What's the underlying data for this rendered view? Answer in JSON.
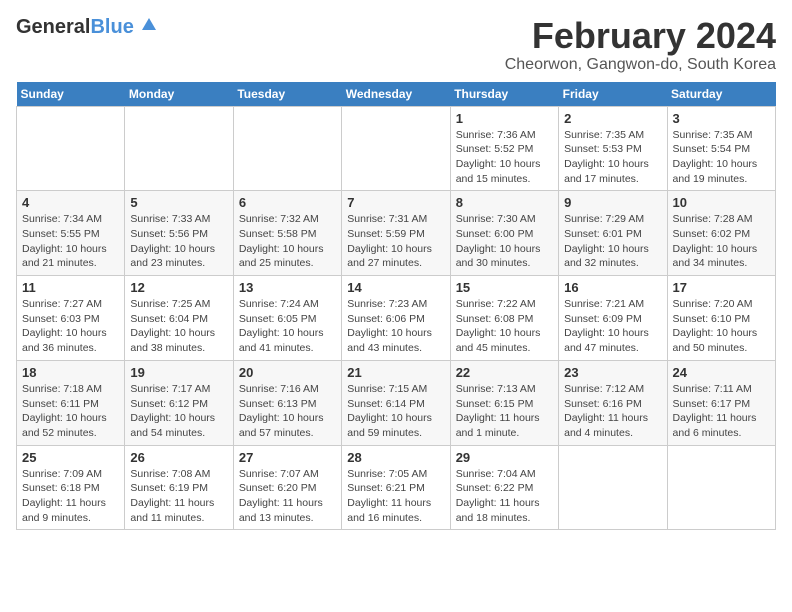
{
  "header": {
    "logo_general": "General",
    "logo_blue": "Blue",
    "title": "February 2024",
    "subtitle": "Cheorwon, Gangwon-do, South Korea"
  },
  "days_of_week": [
    "Sunday",
    "Monday",
    "Tuesday",
    "Wednesday",
    "Thursday",
    "Friday",
    "Saturday"
  ],
  "weeks": [
    [
      {
        "day": "",
        "info": ""
      },
      {
        "day": "",
        "info": ""
      },
      {
        "day": "",
        "info": ""
      },
      {
        "day": "",
        "info": ""
      },
      {
        "day": "1",
        "info": "Sunrise: 7:36 AM\nSunset: 5:52 PM\nDaylight: 10 hours\nand 15 minutes."
      },
      {
        "day": "2",
        "info": "Sunrise: 7:35 AM\nSunset: 5:53 PM\nDaylight: 10 hours\nand 17 minutes."
      },
      {
        "day": "3",
        "info": "Sunrise: 7:35 AM\nSunset: 5:54 PM\nDaylight: 10 hours\nand 19 minutes."
      }
    ],
    [
      {
        "day": "4",
        "info": "Sunrise: 7:34 AM\nSunset: 5:55 PM\nDaylight: 10 hours\nand 21 minutes."
      },
      {
        "day": "5",
        "info": "Sunrise: 7:33 AM\nSunset: 5:56 PM\nDaylight: 10 hours\nand 23 minutes."
      },
      {
        "day": "6",
        "info": "Sunrise: 7:32 AM\nSunset: 5:58 PM\nDaylight: 10 hours\nand 25 minutes."
      },
      {
        "day": "7",
        "info": "Sunrise: 7:31 AM\nSunset: 5:59 PM\nDaylight: 10 hours\nand 27 minutes."
      },
      {
        "day": "8",
        "info": "Sunrise: 7:30 AM\nSunset: 6:00 PM\nDaylight: 10 hours\nand 30 minutes."
      },
      {
        "day": "9",
        "info": "Sunrise: 7:29 AM\nSunset: 6:01 PM\nDaylight: 10 hours\nand 32 minutes."
      },
      {
        "day": "10",
        "info": "Sunrise: 7:28 AM\nSunset: 6:02 PM\nDaylight: 10 hours\nand 34 minutes."
      }
    ],
    [
      {
        "day": "11",
        "info": "Sunrise: 7:27 AM\nSunset: 6:03 PM\nDaylight: 10 hours\nand 36 minutes."
      },
      {
        "day": "12",
        "info": "Sunrise: 7:25 AM\nSunset: 6:04 PM\nDaylight: 10 hours\nand 38 minutes."
      },
      {
        "day": "13",
        "info": "Sunrise: 7:24 AM\nSunset: 6:05 PM\nDaylight: 10 hours\nand 41 minutes."
      },
      {
        "day": "14",
        "info": "Sunrise: 7:23 AM\nSunset: 6:06 PM\nDaylight: 10 hours\nand 43 minutes."
      },
      {
        "day": "15",
        "info": "Sunrise: 7:22 AM\nSunset: 6:08 PM\nDaylight: 10 hours\nand 45 minutes."
      },
      {
        "day": "16",
        "info": "Sunrise: 7:21 AM\nSunset: 6:09 PM\nDaylight: 10 hours\nand 47 minutes."
      },
      {
        "day": "17",
        "info": "Sunrise: 7:20 AM\nSunset: 6:10 PM\nDaylight: 10 hours\nand 50 minutes."
      }
    ],
    [
      {
        "day": "18",
        "info": "Sunrise: 7:18 AM\nSunset: 6:11 PM\nDaylight: 10 hours\nand 52 minutes."
      },
      {
        "day": "19",
        "info": "Sunrise: 7:17 AM\nSunset: 6:12 PM\nDaylight: 10 hours\nand 54 minutes."
      },
      {
        "day": "20",
        "info": "Sunrise: 7:16 AM\nSunset: 6:13 PM\nDaylight: 10 hours\nand 57 minutes."
      },
      {
        "day": "21",
        "info": "Sunrise: 7:15 AM\nSunset: 6:14 PM\nDaylight: 10 hours\nand 59 minutes."
      },
      {
        "day": "22",
        "info": "Sunrise: 7:13 AM\nSunset: 6:15 PM\nDaylight: 11 hours\nand 1 minute."
      },
      {
        "day": "23",
        "info": "Sunrise: 7:12 AM\nSunset: 6:16 PM\nDaylight: 11 hours\nand 4 minutes."
      },
      {
        "day": "24",
        "info": "Sunrise: 7:11 AM\nSunset: 6:17 PM\nDaylight: 11 hours\nand 6 minutes."
      }
    ],
    [
      {
        "day": "25",
        "info": "Sunrise: 7:09 AM\nSunset: 6:18 PM\nDaylight: 11 hours\nand 9 minutes."
      },
      {
        "day": "26",
        "info": "Sunrise: 7:08 AM\nSunset: 6:19 PM\nDaylight: 11 hours\nand 11 minutes."
      },
      {
        "day": "27",
        "info": "Sunrise: 7:07 AM\nSunset: 6:20 PM\nDaylight: 11 hours\nand 13 minutes."
      },
      {
        "day": "28",
        "info": "Sunrise: 7:05 AM\nSunset: 6:21 PM\nDaylight: 11 hours\nand 16 minutes."
      },
      {
        "day": "29",
        "info": "Sunrise: 7:04 AM\nSunset: 6:22 PM\nDaylight: 11 hours\nand 18 minutes."
      },
      {
        "day": "",
        "info": ""
      },
      {
        "day": "",
        "info": ""
      }
    ]
  ]
}
